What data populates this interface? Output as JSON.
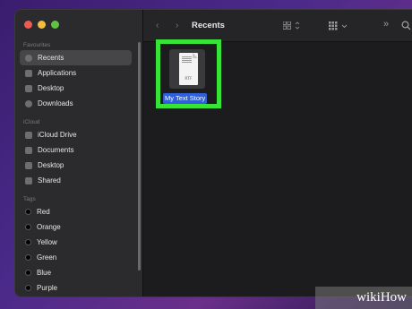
{
  "toolbar": {
    "title": "Recents",
    "back_icon": "chevron-left-icon",
    "forward_icon": "chevron-right-icon",
    "more_glyph": "»",
    "search_icon": "search-icon"
  },
  "sidebar": {
    "favourites_title": "Favourites",
    "favourites": [
      {
        "label": "Recents",
        "icon": "clock-icon",
        "selected": true
      },
      {
        "label": "Applications",
        "icon": "apps-icon"
      },
      {
        "label": "Desktop",
        "icon": "desktop-icon"
      },
      {
        "label": "Downloads",
        "icon": "download-icon"
      }
    ],
    "icloud_title": "iCloud",
    "icloud": [
      {
        "label": "iCloud Drive",
        "icon": "cloud-icon"
      },
      {
        "label": "Documents",
        "icon": "document-icon"
      },
      {
        "label": "Desktop",
        "icon": "desktop-icon"
      },
      {
        "label": "Shared",
        "icon": "shared-folder-icon"
      }
    ],
    "tags_title": "Tags",
    "tags": [
      {
        "label": "Red"
      },
      {
        "label": "Orange"
      },
      {
        "label": "Yellow"
      },
      {
        "label": "Green"
      },
      {
        "label": "Blue"
      },
      {
        "label": "Purple"
      }
    ]
  },
  "file": {
    "name": "My Text Story",
    "ext": "RTF",
    "highlight_color": "#36e336",
    "selection_color": "#2f5fd9"
  },
  "watermark": {
    "text": "wikiHow"
  }
}
